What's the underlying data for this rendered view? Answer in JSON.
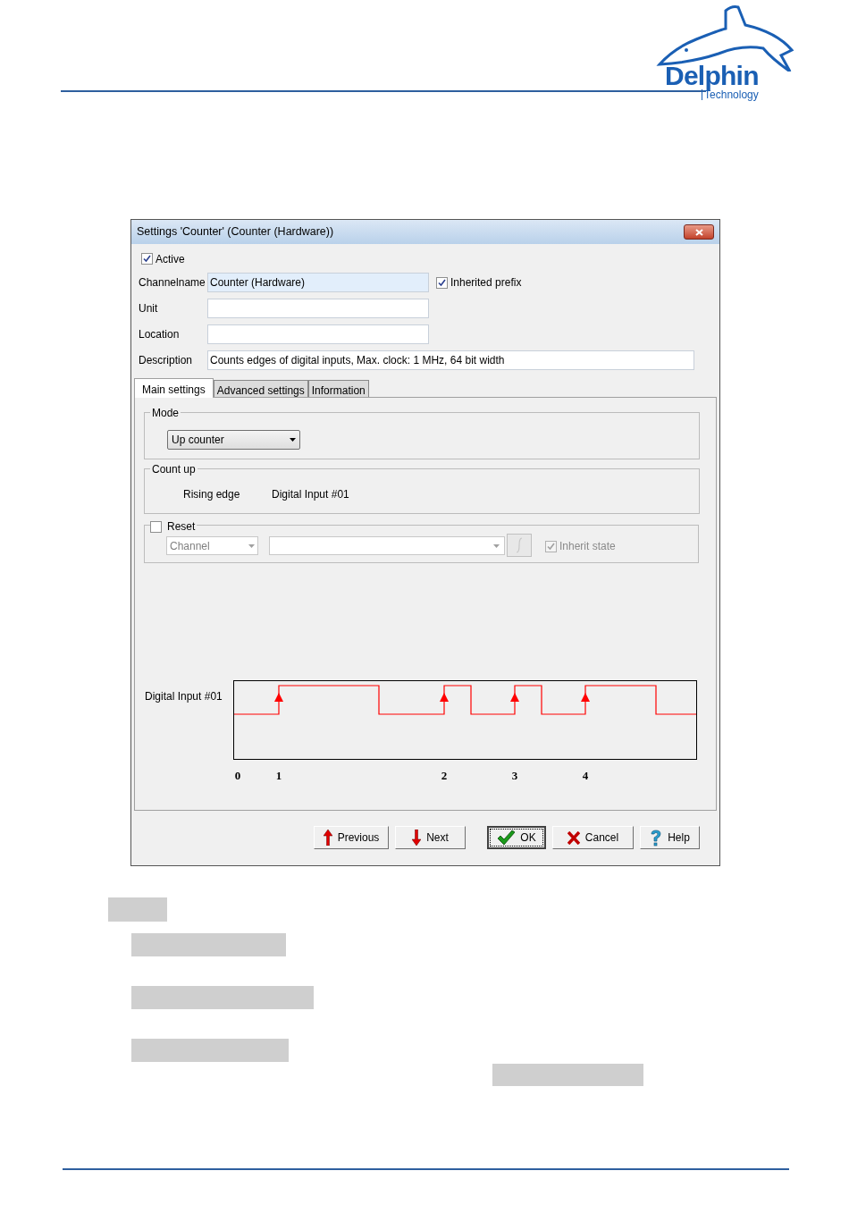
{
  "logo": {
    "name": "Delphin",
    "tagline": "Technology"
  },
  "dialog": {
    "title": "Settings 'Counter' (Counter (Hardware))",
    "active": {
      "label": "Active",
      "checked": true
    },
    "fields": [
      {
        "label": "Channelname",
        "value": "Counter (Hardware)",
        "highlighted": true
      },
      {
        "label": "Unit",
        "highlighted": false
      },
      {
        "label": "Location",
        "highlighted": false
      },
      {
        "label": "Description",
        "value": "Counts edges of digital inputs, Max. clock: 1 MHz, 64 bit width",
        "highlighted": false
      }
    ],
    "inherited_prefix": {
      "label": "Inherited prefix",
      "checked": true
    },
    "tabs": [
      {
        "label": "Main settings",
        "selected": true
      },
      {
        "label": "Advanced settings",
        "selected": false
      },
      {
        "label": "Information",
        "selected": false
      }
    ],
    "mode": {
      "title": "Mode",
      "value": "Up counter"
    },
    "count_up": {
      "title": "Count up",
      "edge": "Rising edge",
      "input": "Digital Input #01"
    },
    "reset": {
      "label": "Reset",
      "checked": false,
      "source": "Channel",
      "inherit_state": {
        "label": "Inherit state",
        "checked": true,
        "disabled": true
      }
    },
    "signal": {
      "label": "Digital Input #01",
      "edge_labels": [
        "0",
        "1",
        "2",
        "3",
        "4"
      ]
    },
    "buttons": [
      {
        "label": "Previous",
        "kind": "previous",
        "default": false
      },
      {
        "label": "Next",
        "kind": "next",
        "default": false
      },
      {
        "label": "OK",
        "kind": "ok",
        "default": true
      },
      {
        "label": "Cancel",
        "kind": "cancel",
        "default": false
      },
      {
        "label": "Help",
        "kind": "help",
        "default": false
      }
    ]
  }
}
